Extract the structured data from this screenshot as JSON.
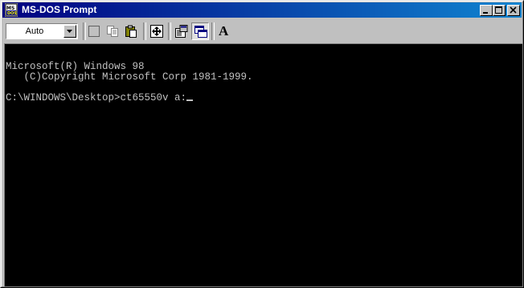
{
  "window": {
    "title": "MS-DOS Prompt",
    "icon": "ms-dos-app-icon",
    "controls": [
      "minimize-icon",
      "maximize-icon",
      "close-icon"
    ]
  },
  "toolbar": {
    "font_size_value": "Auto",
    "buttons": [
      "mark-icon",
      "copy-icon",
      "paste-icon",
      "full-screen-icon",
      "properties-icon",
      "background-icon",
      "font-icon"
    ],
    "font_button_label": "A"
  },
  "console": {
    "lines": [
      "",
      "Microsoft(R) Windows 98",
      "   (C)Copyright Microsoft Corp 1981-1999.",
      "",
      "C:\\WINDOWS\\Desktop>ct65550v a:"
    ],
    "foreground": "#c0c0c0",
    "background": "#000000"
  },
  "colors": {
    "title_start": "#000080",
    "title_end": "#1084d0",
    "face": "#c0c0c0"
  }
}
